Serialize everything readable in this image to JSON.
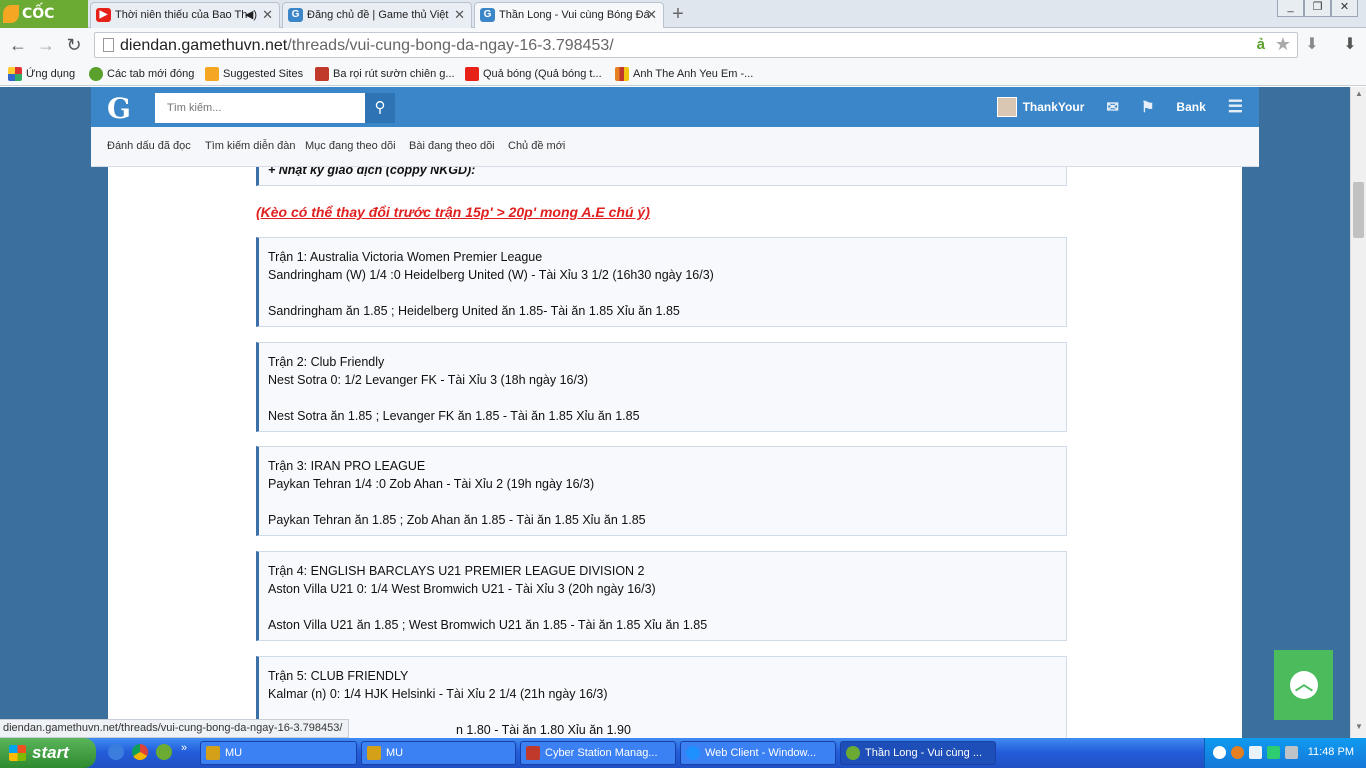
{
  "browser": {
    "brand": "CỐC CỐC",
    "tabs": [
      {
        "title": "Thời niên thiếu của Bao Th",
        "icon": "youtube-icon",
        "color": "#e62117"
      },
      {
        "title": "Đăng chủ đề | Game thủ Việt",
        "icon": "gamethuvn-icon",
        "color": "#3a86c8"
      },
      {
        "title": "Thần Long - Vui cùng Bóng Đá",
        "icon": "gamethuvn-icon",
        "color": "#3a86c8"
      }
    ],
    "url_domain": "diendan.gamethuvn.net",
    "url_path": "/threads/vui-cung-bong-da-ngay-16-3.798453/",
    "bookmarks": [
      {
        "label": "Ứng dụng",
        "color": "#d33"
      },
      {
        "label": "Các tab mới đóng",
        "color": "#5aa02c"
      },
      {
        "label": "Suggested Sites",
        "color": "#f5a623"
      },
      {
        "label": "Ba rọi rút sườn chiên g...",
        "color": "#c0392b"
      },
      {
        "label": "Quả bóng (Quả bóng t...",
        "color": "#e62117"
      },
      {
        "label": "Anh The Anh Yeu Em -...",
        "color": "#e67e22"
      }
    ],
    "status_url": "diendan.gamethuvn.net/threads/vui-cung-bong-da-ngay-16-3.798453/"
  },
  "site": {
    "logo": "G",
    "search_placeholder": "Tìm kiếm...",
    "username": "ThankYour",
    "bank_label": "Bank",
    "subnav": [
      "Đánh dấu đã đọc",
      "Tìm kiếm diễn đàn",
      "Mục đang theo dõi",
      "Bài đang theo dõi",
      "Chủ đề mới"
    ]
  },
  "post": {
    "top_quote_text": "+ Nhật ký giao dịch (coppy NKGD):",
    "note": "(Kèo có thể thay đổi trước trận 15p' > 20p' mong A.E chú ý)",
    "matches": [
      {
        "header": "Trận 1: Australia Victoria Women Premier League",
        "line": "Sandringham (W) 1/4 :0 Heidelberg United (W) - Tài Xỉu 3 1/2 (16h30 ngày 16/3)",
        "odds": "Sandringham ăn 1.85 ; Heidelberg United ăn 1.85- Tài ăn 1.85 Xỉu ăn 1.85"
      },
      {
        "header": "Trận 2: Club Friendly",
        "line": "Nest Sotra 0: 1/2 Levanger FK - Tài Xỉu 3 (18h ngày 16/3)",
        "odds": "Nest Sotra ăn 1.85 ; Levanger FK ăn 1.85 - Tài ăn 1.85 Xỉu ăn 1.85"
      },
      {
        "header": "Trận 3: IRAN PRO LEAGUE",
        "line": "Paykan Tehran 1/4 :0 Zob Ahan - Tài Xỉu 2 (19h ngày 16/3)",
        "odds": "Paykan Tehran ăn 1.85 ; Zob Ahan ăn 1.85 - Tài ăn 1.85 Xỉu ăn 1.85"
      },
      {
        "header": "Trận 4: ENGLISH BARCLAYS U21 PREMIER LEAGUE DIVISION 2",
        "line": "Aston Villa U21 0: 1/4 West Bromwich U21 - Tài Xỉu 3 (20h ngày 16/3)",
        "odds": "Aston Villa U21 ăn 1.85 ; West Bromwich U21 ăn 1.85 - Tài ăn 1.85 Xỉu ăn 1.85"
      },
      {
        "header": "Trận 5: CLUB FRIENDLY",
        "line": "Kalmar (n) 0: 1/4 HJK Helsinki - Tài Xỉu 2 1/4 (21h ngày 16/3)",
        "odds": "n 1.80 - Tài ăn 1.80 Xỉu ăn 1.90"
      }
    ]
  },
  "taskbar": {
    "start_label": "start",
    "tasks": [
      {
        "label": "MU",
        "color": "#d4a017"
      },
      {
        "label": "MU",
        "color": "#d4a017"
      },
      {
        "label": "Cyber Station Manag...",
        "color": "#c0392b"
      },
      {
        "label": "Web Client - Window...",
        "color": "#1e90ff"
      },
      {
        "label": "Thần Long - Vui cùng ...",
        "color": "#6cab33"
      }
    ],
    "clock": "11:48 PM"
  }
}
